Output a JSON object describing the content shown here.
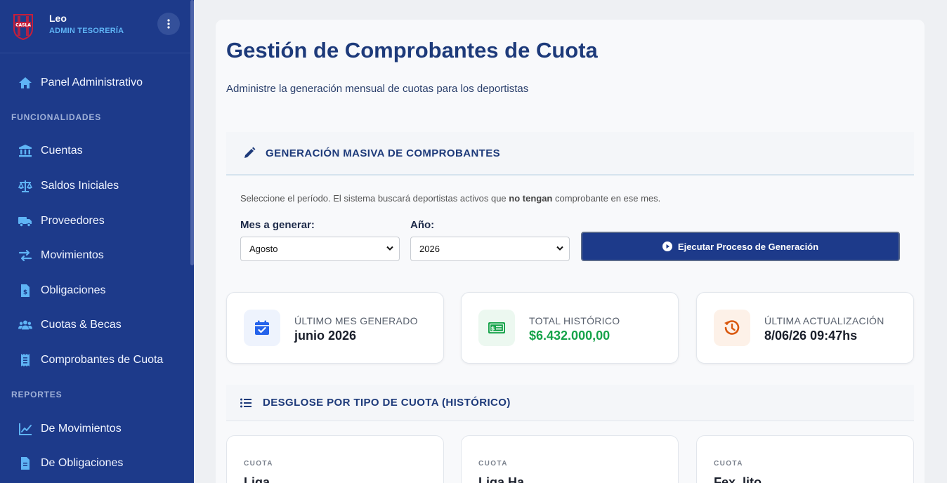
{
  "sidebar": {
    "logo_text": "CASLA",
    "user_name": "Leo",
    "user_role": "ADMIN TESORERÍA",
    "items": [
      {
        "label": "Panel Administrativo",
        "icon": "home-icon"
      },
      {
        "section": "FUNCIONALIDADES"
      },
      {
        "label": "Cuentas",
        "icon": "bank-icon"
      },
      {
        "label": "Saldos Iniciales",
        "icon": "scale-icon"
      },
      {
        "label": "Proveedores",
        "icon": "truck-icon"
      },
      {
        "label": "Movimientos",
        "icon": "arrows-icon"
      },
      {
        "label": "Obligaciones",
        "icon": "invoice-icon"
      },
      {
        "label": "Cuotas & Becas",
        "icon": "users-icon"
      },
      {
        "label": "Comprobantes de Cuota",
        "icon": "receipt-icon"
      },
      {
        "section": "REPORTES"
      },
      {
        "label": "De Movimientos",
        "icon": "chart-line-icon"
      },
      {
        "label": "De Obligaciones",
        "icon": "document-icon"
      }
    ]
  },
  "main": {
    "title": "Gestión de Comprobantes de Cuota",
    "subtitle": "Administre la generación mensual de cuotas para los deportistas",
    "generation": {
      "heading": "GENERACIÓN MASIVA DE COMPROBANTES",
      "note_before": "Seleccione el período. El sistema buscará deportistas activos que ",
      "note_bold": "no tengan",
      "note_after": " comprobante en ese mes.",
      "month_label": "Mes a generar:",
      "month_value": "Agosto",
      "year_label": "Año:",
      "year_value": "2026",
      "run_button": "Ejecutar Proceso de Generación"
    },
    "stats": [
      {
        "label": "ÚLTIMO MES GENERADO",
        "value": "junio 2026",
        "icon": "calendar-check-icon",
        "color": "#2563eb",
        "bg": "#eef3fd",
        "value_color": "#1a1f2b"
      },
      {
        "label": "TOTAL HISTÓRICO",
        "value": "$6.432.000,00",
        "icon": "money-bill-icon",
        "color": "#16a34a",
        "bg": "#ecf8f0",
        "value_color": "#16a34a"
      },
      {
        "label": "ÚLTIMA ACTUALIZACIÓN",
        "value": "8/06/26 09:47hs",
        "icon": "history-icon",
        "color": "#d9580f",
        "bg": "#fdf1e8",
        "value_color": "#1a1f2b"
      }
    ],
    "breakdown": {
      "heading": "DESGLOSE POR TIPO DE CUOTA (HISTÓRICO)",
      "cards": [
        {
          "label": "CUOTA",
          "name": "Liga"
        },
        {
          "label": "CUOTA",
          "name": "Liga Ha..."
        },
        {
          "label": "CUOTA",
          "name": "Fex..lito"
        }
      ]
    }
  }
}
